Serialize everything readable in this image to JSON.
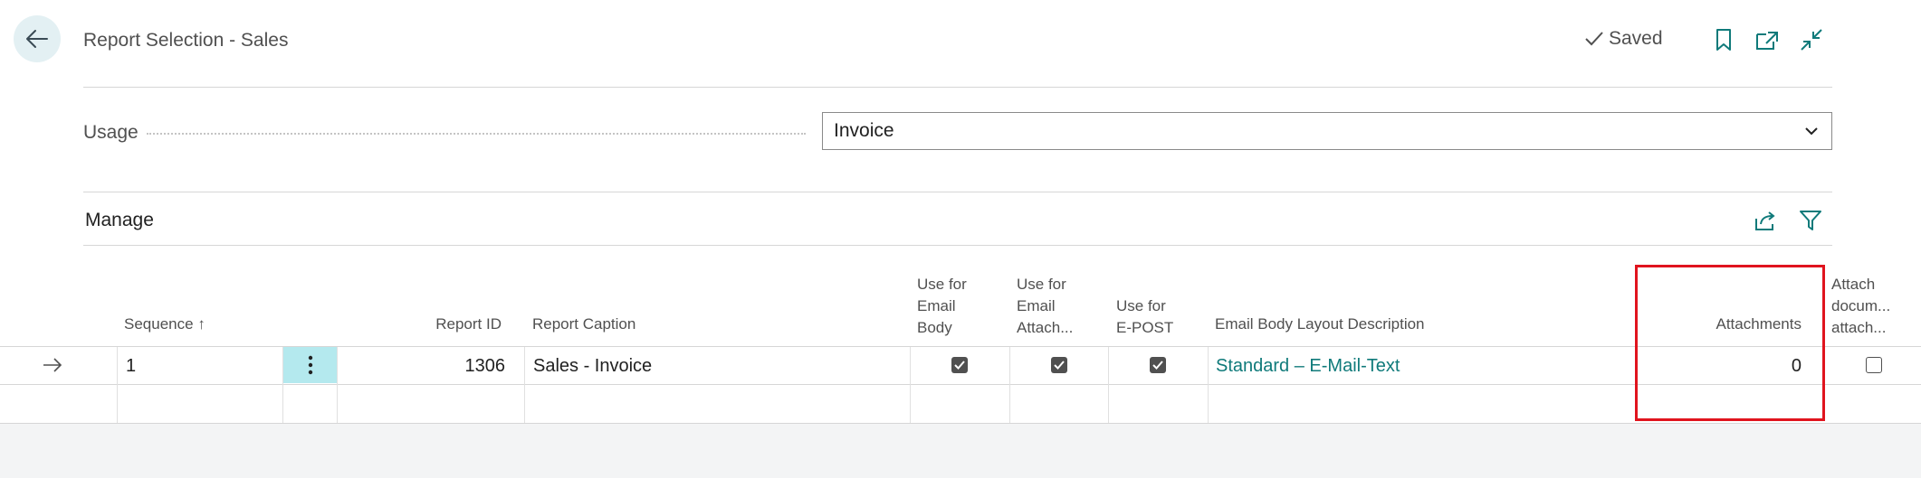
{
  "header": {
    "title": "Report Selection - Sales",
    "status": "Saved"
  },
  "usage": {
    "label": "Usage",
    "value": "Invoice"
  },
  "manage": {
    "label": "Manage"
  },
  "table": {
    "columns": {
      "sequence": "Sequence",
      "sort_indicator": "↑",
      "report_id": "Report ID",
      "report_caption": "Report Caption",
      "use_email_body": [
        "Use for",
        "Email",
        "Body"
      ],
      "use_email_attach": [
        "Use for",
        "Email",
        "Attach..."
      ],
      "use_epost": [
        "Use for",
        "E-POST"
      ],
      "email_body_layout": "Email Body Layout Description",
      "attachments": "Attachments",
      "attach_documents": [
        "Attach",
        "docum...",
        "attach..."
      ]
    },
    "rows": [
      {
        "sequence": "1",
        "report_id": "1306",
        "report_caption": "Sales - Invoice",
        "use_email_body": true,
        "use_email_attach": true,
        "use_epost": true,
        "email_body_layout": "Standard – E-Mail-Text",
        "attachments": "0",
        "attach_documents": false
      }
    ]
  },
  "colors": {
    "accent": "#0f7a7a",
    "highlight_border": "#e0141e",
    "selected_cell": "#b4e9ee"
  }
}
